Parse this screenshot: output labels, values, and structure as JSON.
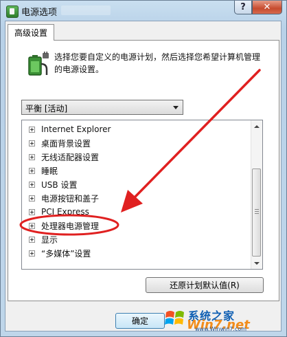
{
  "window": {
    "title": "电源选项",
    "help_label": "?",
    "close_label": "✕"
  },
  "tab": {
    "label": "高级设置"
  },
  "description": "选择您要自定义的电源计划，然后选择您希望计算机管理的电源设置。",
  "plan_select": {
    "value": "平衡 [活动]"
  },
  "tree": {
    "items": [
      {
        "label": "Internet Explorer"
      },
      {
        "label": "桌面背景设置"
      },
      {
        "label": "无线适配器设置"
      },
      {
        "label": "睡眠"
      },
      {
        "label": "USB 设置"
      },
      {
        "label": "电源按钮和盖子"
      },
      {
        "label": "PCI Express"
      },
      {
        "label": "处理器电源管理"
      },
      {
        "label": "显示"
      },
      {
        "label": "“多媒体”设置"
      }
    ]
  },
  "buttons": {
    "restore_label": "还原计划默认值(R)",
    "ok_label": "确定"
  },
  "watermark": {
    "brand": "系统之家",
    "win_text": "Win7.net",
    "url": "www.Winwin7.com"
  },
  "colors": {
    "annotation_red": "#e02020",
    "ok_border": "#3c7fb1"
  }
}
